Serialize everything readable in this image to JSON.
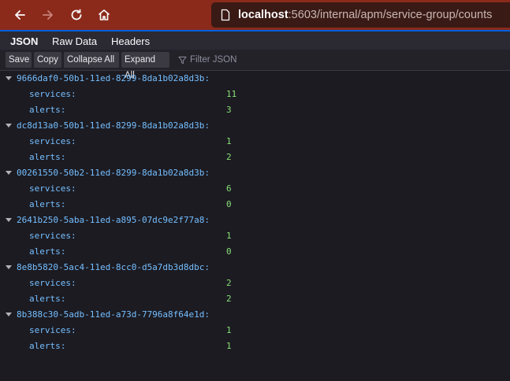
{
  "browser": {
    "url_host": "localhost",
    "url_rest": ":5603/internal/apm/service-group/counts"
  },
  "viewer": {
    "tabs": [
      "JSON",
      "Raw Data",
      "Headers"
    ],
    "buttons": [
      "Save",
      "Copy",
      "Collapse All",
      "Expand All"
    ],
    "filter_placeholder": "Filter JSON"
  },
  "groups": [
    {
      "id": "9666daf0-50b1-11ed-8299-8da1b02a8d3b:",
      "services": "11",
      "alerts": "3"
    },
    {
      "id": "dc8d13a0-50b1-11ed-8299-8da1b02a8d3b:",
      "services": "1",
      "alerts": "2"
    },
    {
      "id": "00261550-50b2-11ed-8299-8da1b02a8d3b:",
      "services": "6",
      "alerts": "0"
    },
    {
      "id": "2641b250-5aba-11ed-a895-07dc9e2f77a8:",
      "services": "1",
      "alerts": "0"
    },
    {
      "id": "8e8b5820-5ac4-11ed-8cc0-d5a7db3d8dbc:",
      "services": "2",
      "alerts": "2"
    },
    {
      "id": "8b388c30-5adb-11ed-a73d-7796a8f64e1d:",
      "services": "1",
      "alerts": "1"
    }
  ],
  "labels": {
    "services": "services:",
    "alerts": "alerts:"
  }
}
